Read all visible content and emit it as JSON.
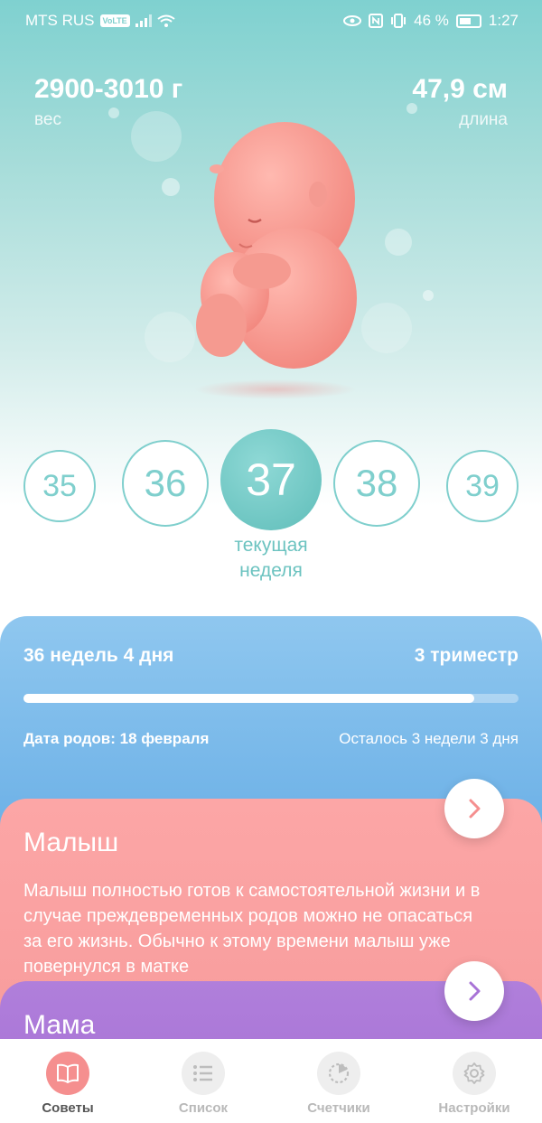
{
  "status_bar": {
    "carrier": "MTS RUS",
    "volte": "VoLTE",
    "battery": "46 %",
    "time": "1:27"
  },
  "stats": {
    "weight_value": "2900-3010 г",
    "weight_label": "вес",
    "length_value": "47,9 см",
    "length_label": "длина"
  },
  "weeks": {
    "items": [
      "35",
      "36",
      "37",
      "38",
      "39"
    ],
    "current": "37",
    "current_label_line1": "текущая",
    "current_label_line2": "неделя"
  },
  "progress": {
    "elapsed": "36 недель 4 дня",
    "trimester": "3 триместр",
    "fraction": 0.91,
    "due_date": "Дата родов: 18 февраля",
    "remaining": "Осталось 3 недели 3 дня"
  },
  "cards": {
    "baby": {
      "title": "Малыш",
      "text": "Малыш полностью готов к самостоятельной жизни и в случае преждевременных родов можно не опасаться за его жизнь. Обычно к этому времени малыш уже повернулся в матке"
    },
    "mama": {
      "title": "Мама"
    }
  },
  "tabs": [
    {
      "label": "Советы",
      "icon": "book-icon",
      "active": true
    },
    {
      "label": "Список",
      "icon": "list-icon",
      "active": false
    },
    {
      "label": "Счетчики",
      "icon": "timer-icon",
      "active": false
    },
    {
      "label": "Настройки",
      "icon": "gear-icon",
      "active": false
    }
  ],
  "colors": {
    "accent_teal": "#7fcfcd",
    "progress_blue": "#6aafe6",
    "baby_card": "#f79b9b",
    "mama_card": "#a873d6",
    "active_tab": "#f58f8f"
  }
}
